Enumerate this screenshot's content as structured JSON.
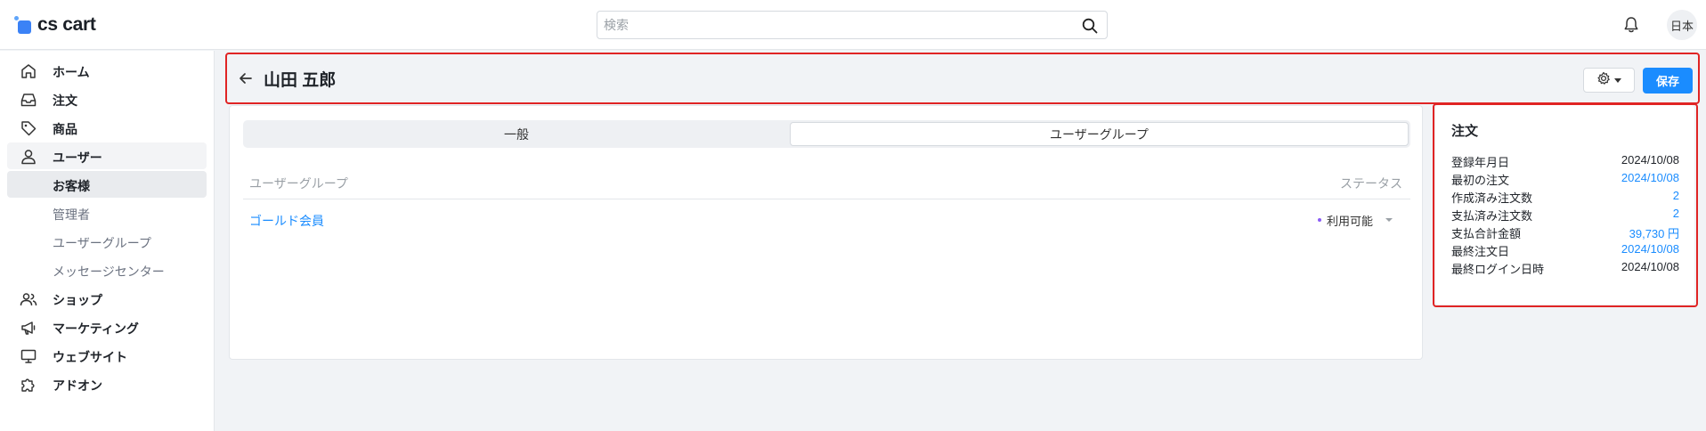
{
  "app": {
    "logo_text": "cs cart"
  },
  "search": {
    "placeholder": "検索",
    "value": ""
  },
  "topbar": {
    "avatar_label": "日本"
  },
  "sidebar": {
    "items": [
      {
        "label": "ホーム",
        "icon": "home-icon"
      },
      {
        "label": "注文",
        "icon": "inbox-icon"
      },
      {
        "label": "商品",
        "icon": "tag-icon"
      },
      {
        "label": "ユーザー",
        "icon": "user-icon"
      },
      {
        "label": "ショップ",
        "icon": "users-icon"
      },
      {
        "label": "マーケティング",
        "icon": "megaphone-icon"
      },
      {
        "label": "ウェブサイト",
        "icon": "monitor-icon"
      },
      {
        "label": "アドオン",
        "icon": "puzzle-icon"
      }
    ],
    "subitems": [
      {
        "label": "お客様",
        "active": true
      },
      {
        "label": "管理者",
        "active": false
      },
      {
        "label": "ユーザーグループ",
        "active": false
      },
      {
        "label": "メッセージセンター",
        "active": false
      }
    ]
  },
  "header": {
    "title": "山田 五郎",
    "save_label": "保存"
  },
  "tabs": [
    {
      "label": "一般",
      "active": false
    },
    {
      "label": "ユーザーグループ",
      "active": true
    }
  ],
  "table": {
    "columns": [
      "ユーザーグループ",
      "ステータス"
    ],
    "rows": [
      {
        "group": "ゴールド会員",
        "status": "利用可能"
      }
    ]
  },
  "side_panel": {
    "title": "注文",
    "rows": [
      {
        "label": "登録年月日",
        "value": "2024/10/08",
        "link": false
      },
      {
        "label": "最初の注文",
        "value": "2024/10/08",
        "link": true
      },
      {
        "label": "作成済み注文数",
        "value": "2",
        "link": true
      },
      {
        "label": "支払済み注文数",
        "value": "2",
        "link": true
      },
      {
        "label": "支払合計金額",
        "value": "39,730 円",
        "link": true
      },
      {
        "label": "最終注文日",
        "value": "2024/10/08",
        "link": true
      },
      {
        "label": "最終ログイン日時",
        "value": "2024/10/08",
        "link": false
      }
    ]
  },
  "colors": {
    "accent": "#1a8cff",
    "highlight": "#e02424",
    "status_dot": "#8b5cf6"
  }
}
